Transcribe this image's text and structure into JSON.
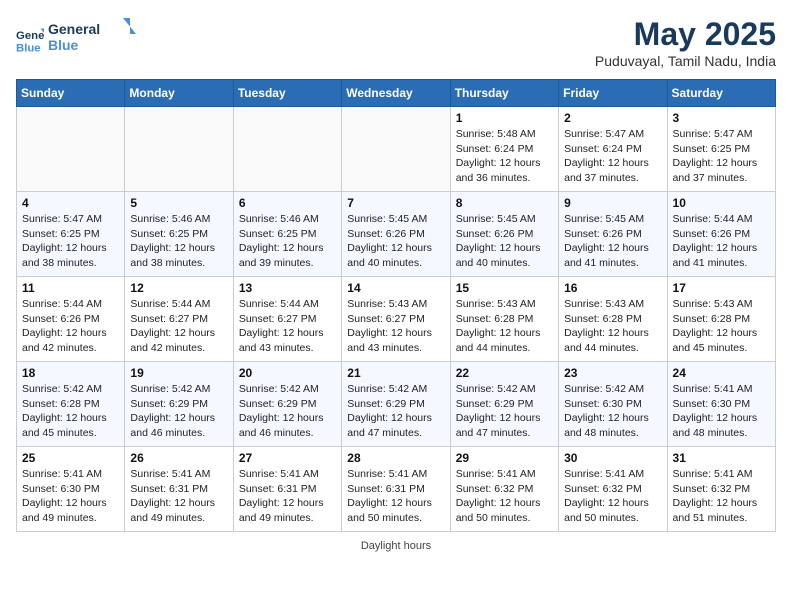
{
  "header": {
    "logo_line1": "General",
    "logo_line2": "Blue",
    "month": "May 2025",
    "location": "Puduvayal, Tamil Nadu, India"
  },
  "days_of_week": [
    "Sunday",
    "Monday",
    "Tuesday",
    "Wednesday",
    "Thursday",
    "Friday",
    "Saturday"
  ],
  "weeks": [
    [
      {
        "day": "",
        "info": ""
      },
      {
        "day": "",
        "info": ""
      },
      {
        "day": "",
        "info": ""
      },
      {
        "day": "",
        "info": ""
      },
      {
        "day": "1",
        "info": "Sunrise: 5:48 AM\nSunset: 6:24 PM\nDaylight: 12 hours and 36 minutes."
      },
      {
        "day": "2",
        "info": "Sunrise: 5:47 AM\nSunset: 6:24 PM\nDaylight: 12 hours and 37 minutes."
      },
      {
        "day": "3",
        "info": "Sunrise: 5:47 AM\nSunset: 6:25 PM\nDaylight: 12 hours and 37 minutes."
      }
    ],
    [
      {
        "day": "4",
        "info": "Sunrise: 5:47 AM\nSunset: 6:25 PM\nDaylight: 12 hours and 38 minutes."
      },
      {
        "day": "5",
        "info": "Sunrise: 5:46 AM\nSunset: 6:25 PM\nDaylight: 12 hours and 38 minutes."
      },
      {
        "day": "6",
        "info": "Sunrise: 5:46 AM\nSunset: 6:25 PM\nDaylight: 12 hours and 39 minutes."
      },
      {
        "day": "7",
        "info": "Sunrise: 5:45 AM\nSunset: 6:26 PM\nDaylight: 12 hours and 40 minutes."
      },
      {
        "day": "8",
        "info": "Sunrise: 5:45 AM\nSunset: 6:26 PM\nDaylight: 12 hours and 40 minutes."
      },
      {
        "day": "9",
        "info": "Sunrise: 5:45 AM\nSunset: 6:26 PM\nDaylight: 12 hours and 41 minutes."
      },
      {
        "day": "10",
        "info": "Sunrise: 5:44 AM\nSunset: 6:26 PM\nDaylight: 12 hours and 41 minutes."
      }
    ],
    [
      {
        "day": "11",
        "info": "Sunrise: 5:44 AM\nSunset: 6:26 PM\nDaylight: 12 hours and 42 minutes."
      },
      {
        "day": "12",
        "info": "Sunrise: 5:44 AM\nSunset: 6:27 PM\nDaylight: 12 hours and 42 minutes."
      },
      {
        "day": "13",
        "info": "Sunrise: 5:44 AM\nSunset: 6:27 PM\nDaylight: 12 hours and 43 minutes."
      },
      {
        "day": "14",
        "info": "Sunrise: 5:43 AM\nSunset: 6:27 PM\nDaylight: 12 hours and 43 minutes."
      },
      {
        "day": "15",
        "info": "Sunrise: 5:43 AM\nSunset: 6:28 PM\nDaylight: 12 hours and 44 minutes."
      },
      {
        "day": "16",
        "info": "Sunrise: 5:43 AM\nSunset: 6:28 PM\nDaylight: 12 hours and 44 minutes."
      },
      {
        "day": "17",
        "info": "Sunrise: 5:43 AM\nSunset: 6:28 PM\nDaylight: 12 hours and 45 minutes."
      }
    ],
    [
      {
        "day": "18",
        "info": "Sunrise: 5:42 AM\nSunset: 6:28 PM\nDaylight: 12 hours and 45 minutes."
      },
      {
        "day": "19",
        "info": "Sunrise: 5:42 AM\nSunset: 6:29 PM\nDaylight: 12 hours and 46 minutes."
      },
      {
        "day": "20",
        "info": "Sunrise: 5:42 AM\nSunset: 6:29 PM\nDaylight: 12 hours and 46 minutes."
      },
      {
        "day": "21",
        "info": "Sunrise: 5:42 AM\nSunset: 6:29 PM\nDaylight: 12 hours and 47 minutes."
      },
      {
        "day": "22",
        "info": "Sunrise: 5:42 AM\nSunset: 6:29 PM\nDaylight: 12 hours and 47 minutes."
      },
      {
        "day": "23",
        "info": "Sunrise: 5:42 AM\nSunset: 6:30 PM\nDaylight: 12 hours and 48 minutes."
      },
      {
        "day": "24",
        "info": "Sunrise: 5:41 AM\nSunset: 6:30 PM\nDaylight: 12 hours and 48 minutes."
      }
    ],
    [
      {
        "day": "25",
        "info": "Sunrise: 5:41 AM\nSunset: 6:30 PM\nDaylight: 12 hours and 49 minutes."
      },
      {
        "day": "26",
        "info": "Sunrise: 5:41 AM\nSunset: 6:31 PM\nDaylight: 12 hours and 49 minutes."
      },
      {
        "day": "27",
        "info": "Sunrise: 5:41 AM\nSunset: 6:31 PM\nDaylight: 12 hours and 49 minutes."
      },
      {
        "day": "28",
        "info": "Sunrise: 5:41 AM\nSunset: 6:31 PM\nDaylight: 12 hours and 50 minutes."
      },
      {
        "day": "29",
        "info": "Sunrise: 5:41 AM\nSunset: 6:32 PM\nDaylight: 12 hours and 50 minutes."
      },
      {
        "day": "30",
        "info": "Sunrise: 5:41 AM\nSunset: 6:32 PM\nDaylight: 12 hours and 50 minutes."
      },
      {
        "day": "31",
        "info": "Sunrise: 5:41 AM\nSunset: 6:32 PM\nDaylight: 12 hours and 51 minutes."
      }
    ]
  ],
  "footer": {
    "daylight_label": "Daylight hours"
  }
}
